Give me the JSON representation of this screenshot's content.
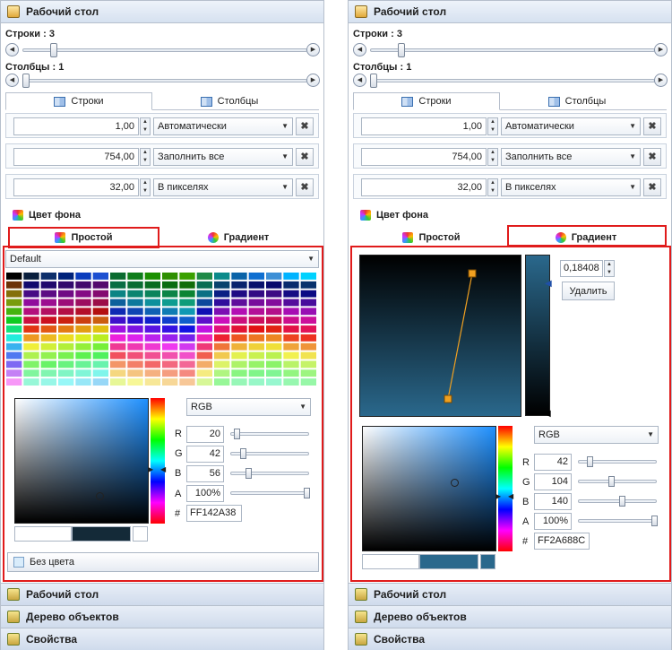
{
  "panels": [
    {
      "title": "Рабочий стол",
      "rows_label": "Строки : 3",
      "cols_label": "Столбцы : 1",
      "tabs": [
        "Строки",
        "Столбцы"
      ],
      "rows": [
        {
          "value": "1,00",
          "mode": "Автоматически"
        },
        {
          "value": "754,00",
          "mode": "Заполнить все"
        },
        {
          "value": "32,00",
          "mode": "В пикселях"
        }
      ],
      "bg_label": "Цвет фона",
      "fill_tabs": [
        "Простой",
        "Градиент"
      ],
      "selected_fill": "Простой",
      "palette_name": "Default",
      "mode": "RGB",
      "channels": [
        {
          "k": "R",
          "v": "20"
        },
        {
          "k": "G",
          "v": "42"
        },
        {
          "k": "B",
          "v": "56"
        },
        {
          "k": "A",
          "v": "100%"
        }
      ],
      "hex": "FF142A38",
      "color": "#142A38",
      "no_color": "Без цвета",
      "groups": [
        "Рабочий стол",
        "Дерево объектов",
        "Свойства"
      ]
    },
    {
      "title": "Рабочий стол",
      "rows_label": "Строки : 3",
      "cols_label": "Столбцы : 1",
      "tabs": [
        "Строки",
        "Столбцы"
      ],
      "rows": [
        {
          "value": "1,00",
          "mode": "Автоматически"
        },
        {
          "value": "754,00",
          "mode": "Заполнить все"
        },
        {
          "value": "32,00",
          "mode": "В пикселях"
        }
      ],
      "bg_label": "Цвет фона",
      "fill_tabs": [
        "Простой",
        "Градиент"
      ],
      "selected_fill": "Градиент",
      "stop_offset": "0,18408",
      "delete": "Удалить",
      "mode": "RGB",
      "channels": [
        {
          "k": "R",
          "v": "42"
        },
        {
          "k": "G",
          "v": "104"
        },
        {
          "k": "B",
          "v": "140"
        },
        {
          "k": "A",
          "v": "100%"
        }
      ],
      "hex": "FF2A688C",
      "color": "#2A688C",
      "groups": [
        "Рабочий стол",
        "Дерево объектов",
        "Свойства"
      ]
    }
  ],
  "palette_columns": [
    "#000000",
    "#0a1f3d",
    "#0d2f6b",
    "#00227a",
    "#0a3cbd",
    "#1c4fd1",
    "#0a6b2f",
    "#0e7d1a",
    "#1a8f00",
    "#2e8f00",
    "#3aa000",
    "#1f8a47",
    "#0b8a8a",
    "#0a63a8",
    "#0f6fd1",
    "#3d8fd6",
    "#00b3ff",
    "#00d2ff"
  ]
}
